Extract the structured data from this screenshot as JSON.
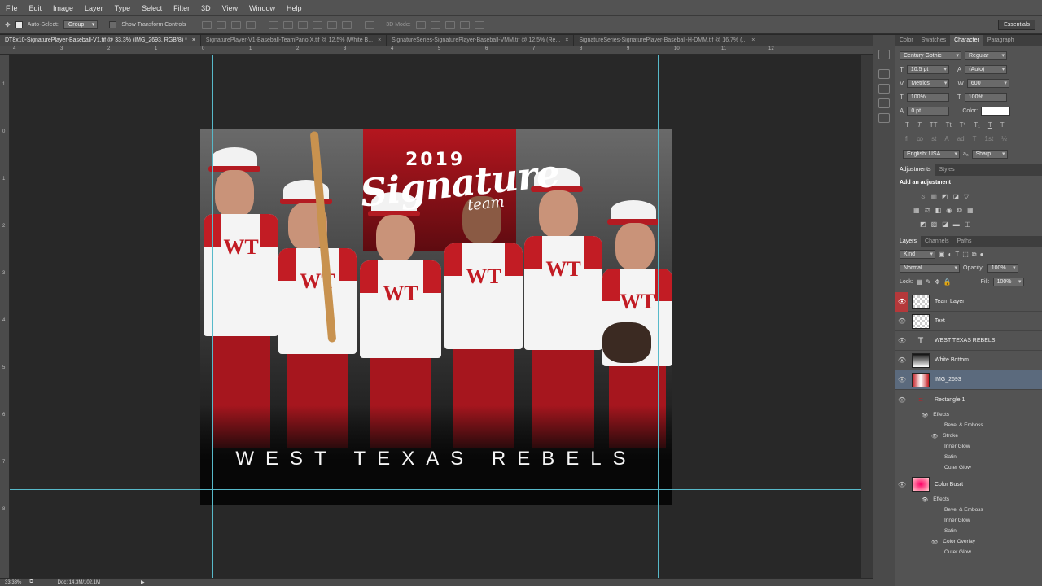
{
  "menu": [
    "File",
    "Edit",
    "Image",
    "Layer",
    "Type",
    "Select",
    "Filter",
    "3D",
    "View",
    "Window",
    "Help"
  ],
  "options": {
    "auto_select_label": "Auto-Select:",
    "auto_select_value": "Group",
    "show_transform_label": "Show Transform Controls",
    "mode_3d_label": "3D Mode:",
    "workspace": "Essentials"
  },
  "tabs": [
    {
      "label": "DT8x10-SignaturePlayer-Baseball-V1.tif @ 33.3% (IMG_2693, RGB/8) *",
      "active": true
    },
    {
      "label": "SignaturePlayer-V1-Baseball-TeamPano X.tif @ 12.5% (White B...",
      "active": false
    },
    {
      "label": "SignatureSeries-SignaturePlayer-Baseball-VMM.tif @ 12.5% (Re...",
      "active": false
    },
    {
      "label": "SignatureSeries-SignaturePlayer-Baseball-H-DMM.tif @ 16.7% (...",
      "active": false
    }
  ],
  "ruler_h": [
    "4",
    "3",
    "2",
    "1",
    "0",
    "1",
    "2",
    "3",
    "4",
    "5",
    "6",
    "7",
    "8",
    "9",
    "10",
    "11",
    "12"
  ],
  "ruler_v": [
    "1",
    "0",
    "1",
    "2",
    "3",
    "4",
    "5",
    "6",
    "7",
    "8"
  ],
  "artwork": {
    "year": "2019",
    "script_title": "Signature",
    "script_sub": "team",
    "jersey_logo": "WT",
    "team_name": "WEST TEXAS REBELS"
  },
  "status": {
    "zoom": "33.33%",
    "doc": "Doc: 14.3M/102.1M"
  },
  "character_panel": {
    "tabs": [
      "Color",
      "Swatches",
      "Character",
      "Paragraph"
    ],
    "font_family": "Century Gothic",
    "font_style": "Regular",
    "font_size": "10.5 pt",
    "leading": "(Auto)",
    "kerning": "Metrics",
    "tracking": "600",
    "vscale": "100%",
    "hscale": "100%",
    "baseline": "0 pt",
    "color_label": "Color:",
    "color_value": "#ffffff",
    "language": "English: USA",
    "aa_label": "aₐ",
    "antialias": "Sharp"
  },
  "adjustments": {
    "tabs": [
      "Adjustments",
      "Styles"
    ],
    "title": "Add an adjustment"
  },
  "layers_panel": {
    "tabs": [
      "Layers",
      "Channels",
      "Paths"
    ],
    "filter_kind": "Kind",
    "blend_mode": "Normal",
    "opacity_label": "Opacity:",
    "opacity": "100%",
    "lock_label": "Lock:",
    "fill_label": "Fill:",
    "fill": "100%",
    "layers": [
      {
        "name": "Team Layer",
        "type": "raster",
        "highlight": "red"
      },
      {
        "name": "Text",
        "type": "raster"
      },
      {
        "name": "WEST TEXAS REBELS",
        "type": "text"
      },
      {
        "name": "White Bottom",
        "type": "raster"
      },
      {
        "name": "IMG_2693",
        "type": "image",
        "selected": true
      }
    ],
    "rect_layer": {
      "name": "Rectangle 1",
      "effects_label": "Effects",
      "effects": [
        "Bevel & Emboss",
        "Stroke",
        "Inner Glow",
        "Satin",
        "Outer Glow"
      ]
    },
    "burst_layer": {
      "name": "Color Busrt",
      "effects_label": "Effects",
      "effects": [
        "Bevel & Emboss",
        "Inner Glow",
        "Satin",
        "Color Overlay",
        "Outer Glow"
      ]
    }
  }
}
